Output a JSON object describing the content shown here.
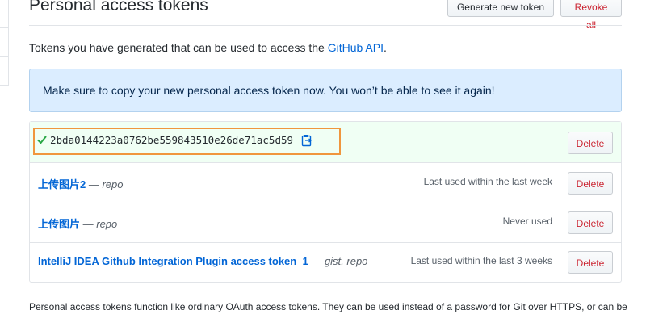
{
  "header": {
    "title": "Personal access tokens",
    "generate_label": "Generate new token",
    "revoke_label": "Revoke all"
  },
  "intro": {
    "text": "Tokens you have generated that can be used to access the ",
    "link": "GitHub API",
    "suffix": "."
  },
  "flash": {
    "message": "Make sure to copy your new personal access token now. You won’t be able to see it again!"
  },
  "new_token": {
    "value": "2bda0144223a0762be559843510e26de71ac5d59",
    "delete_label": "Delete",
    "colors": {
      "highlight": "#f0963d",
      "check": "#28a745"
    }
  },
  "tokens": [
    {
      "name": "上传图片2",
      "separator": " — ",
      "scope": "repo",
      "last_used": "Last used within the last week",
      "delete_label": "Delete"
    },
    {
      "name": "上传图片",
      "separator": " — ",
      "scope": "repo",
      "last_used": "Never used",
      "delete_label": "Delete"
    },
    {
      "name": "IntelliJ IDEA Github Integration Plugin access token_1",
      "separator": " — ",
      "scope": "gist, repo",
      "last_used": "Last used within the last 3 weeks",
      "delete_label": "Delete"
    }
  ],
  "footer": {
    "text": "Personal access tokens function like ordinary OAuth access tokens. They can be used instead of a password for Git over HTTPS, or can be"
  }
}
